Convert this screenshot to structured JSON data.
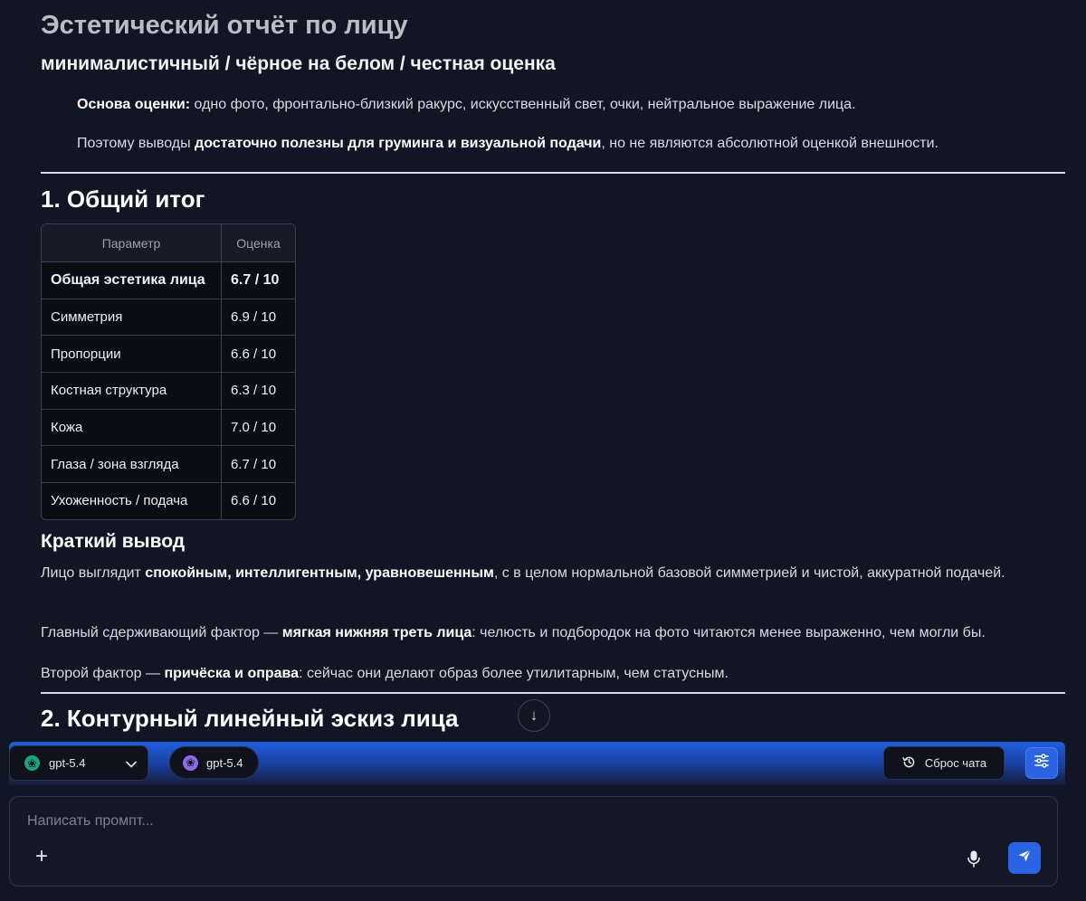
{
  "report": {
    "title": "Эстетический отчёт по лицу",
    "subtitle": "минималистичный / чёрное на белом / честная оценка",
    "basis_label": "Основа оценки:",
    "basis_text": " одно фото, фронтально-близкий ракурс, искусственный свет, очки, нейтральное выражение лица.",
    "note_pre": "Поэтому выводы ",
    "note_bold": "достаточно полезны для груминга и визуальной подачи",
    "note_post": ", но не являются абсолютной оценкой внешности."
  },
  "section1": {
    "title": "1. Общий итог",
    "table": {
      "headers": [
        "Параметр",
        "Оценка"
      ],
      "rows": [
        {
          "param": "Общая эстетика лица",
          "score": "6.7 / 10",
          "bold": true
        },
        {
          "param": "Симметрия",
          "score": "6.9 / 10"
        },
        {
          "param": "Пропорции",
          "score": "6.6 / 10"
        },
        {
          "param": "Костная структура",
          "score": "6.3 / 10"
        },
        {
          "param": "Кожа",
          "score": "7.0 / 10"
        },
        {
          "param": "Глаза / зона взгляда",
          "score": "6.7 / 10"
        },
        {
          "param": "Ухоженность / подача",
          "score": "6.6 / 10"
        }
      ]
    },
    "summary_title": "Краткий вывод",
    "summary_p1_pre": "Лицо выглядит ",
    "summary_p1_bold": "спокойным, интеллигентным, уравновешенным",
    "summary_p1_post": ", с в целом нормальной базовой симметрией и чистой, аккуратной подачей.",
    "summary_p2_pre": "Главный сдерживающий фактор — ",
    "summary_p2_bold": "мягкая нижняя треть лица",
    "summary_p2_post": ": челюсть и подбородок на фото читаются менее выраженно, чем могли бы.",
    "summary_p3_pre": "Второй фактор — ",
    "summary_p3_bold": "причёска и оправа",
    "summary_p3_post": ": сейчас они делают образ более утилитарным, чем статусным."
  },
  "section2": {
    "title": "2. Контурный линейный эскиз лица"
  },
  "toolbar": {
    "model_select_label": "gpt-5.4",
    "model_pill_label": "gpt-5.4",
    "reset_label": "Сброс чата"
  },
  "prompt": {
    "placeholder": "Написать промпт...",
    "value": ""
  },
  "icons": {
    "scroll_down": "arrow-down-icon",
    "reset": "history-icon",
    "settings": "sliders-icon",
    "add": "plus-icon",
    "mic": "microphone-icon",
    "send": "send-icon"
  },
  "colors": {
    "background": "#121624",
    "accent": "#2a63e3"
  }
}
